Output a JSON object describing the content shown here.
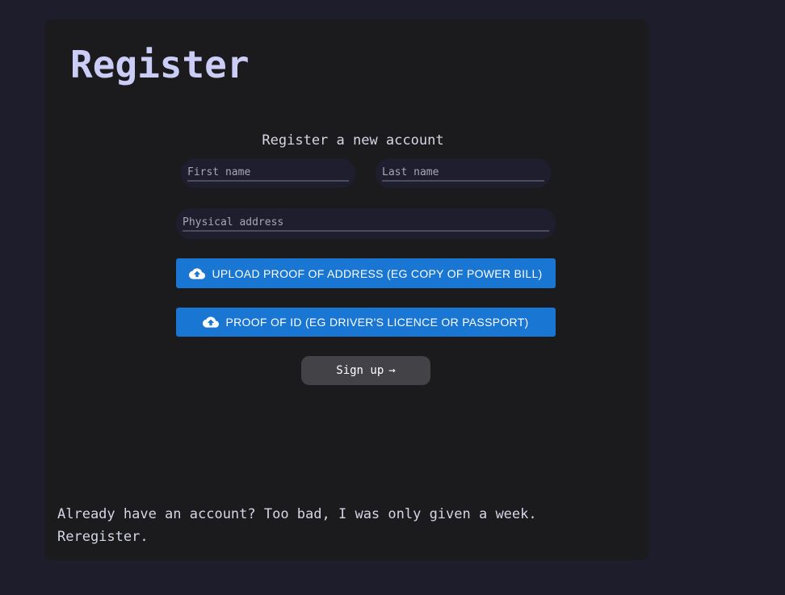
{
  "page": {
    "title": "Register"
  },
  "form": {
    "heading": "Register a new account",
    "first_name_placeholder": "First name",
    "last_name_placeholder": "Last name",
    "address_placeholder": "Physical address",
    "upload_address_label": "UPLOAD PROOF OF ADDRESS (EG COPY OF POWER BILL)",
    "upload_id_label": "PROOF OF ID (EG DRIVER'S LICENCE OR PASSPORT)",
    "signup_label": "Sign up",
    "signup_arrow": "→"
  },
  "footer": {
    "line1": "Already have an account? Too bad, I was only given a week.",
    "line2": "Reregister."
  },
  "colors": {
    "background": "#1e1d2b",
    "card": "#1b1b1d",
    "title": "#cbcdf6",
    "input_bg": "#1f1e2e",
    "upload_button": "#1976d2",
    "signup_button": "#434347"
  },
  "icons": {
    "upload": "cloud-upload-icon",
    "arrow": "arrow-right-icon"
  }
}
